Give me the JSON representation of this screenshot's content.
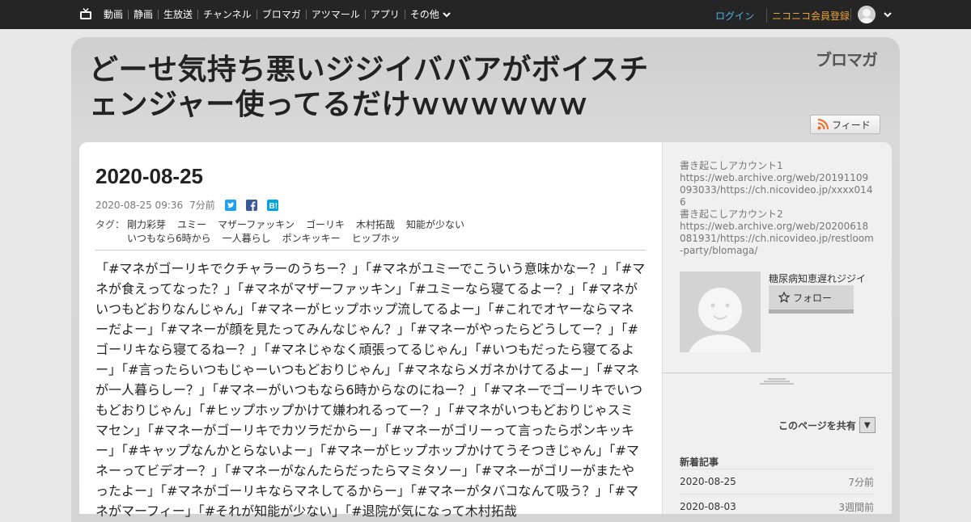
{
  "nav": {
    "items": [
      "動画",
      "静画",
      "生放送",
      "チャンネル",
      "ブロマガ",
      "アツマール",
      "アプリ"
    ],
    "more": "その他",
    "login": "ログイン",
    "register": "ニコニコ会員登録"
  },
  "header": {
    "blog_title": "どーせ気持ち悪いジジイババアがボイスチェンジャー使ってるだけｗｗｗｗｗｗ",
    "brand_logo": "ブロマガ",
    "feed_label": "フィード"
  },
  "article": {
    "date_title": "2020-08-25",
    "posted_at": "2020-08-25 09:36",
    "posted_ago": "7分前",
    "tags_label": "タグ：",
    "tags": [
      "剛力彩芽",
      "ユミー",
      "マザーファッキン",
      "ゴーリキ",
      "木村拓哉",
      "知能が少ない",
      "いつもなら6時から",
      "一人暮らし",
      "ポンキッキー",
      "ヒップホッ"
    ],
    "body": "「#マネがゴーリキでクチャラーのうちー？」「#マネがユミーでこういう意味かなー？」「#マネが食えってなった？」「#マネがマザーファッキン」「#ユミーなら寝てるよー？」「#マネがいつもどおりなんじゃん」「#マネーがヒップホップ流してるよー」「#これでオヤーならマネーだよー」「#マネーが顔を見たってみんなじゃん？」「#マネーがやったらどうしてー？」「#ゴーリキなら寝てるねー？」「#マネじゃなく頑張ってるじゃん」「#いつもだったら寝てるよー」「#言ったらいつもじゃーいつもどおりじゃん」「#マネならメガネかけてるよー」「#マネが一人暮らしー？」「#マネーがいつもなら6時からなのにねー？」「#マネーでゴーリキでいつもどおりじゃん」「#ヒップホップかけて嫌われるってー？」「#マネがいつもどおりじゃスミマセン」「#マネーがゴーリキでカツラだからー」「#マネーがゴリーって言ったらポンキッキー」「#キャップなんかとらないよー」「#マネーがヒップホップかけてうそつきじゃん」「#マネーってビデオー？」「#マネーがなんたらだったらマミタソー」「#マネーがゴリーがまたやったよー」「#マネがゴーリキならマネしてるからー」「#マネーがタバコなんて吸う？」「#マネがマーフィー」「#それが知能が少ない」「#退院が気になって木村拓哉"
  },
  "sidebar": {
    "profile_lines": [
      "書き起こしアカウント1",
      "https://web.archive.org/web/20191109093033/https://ch.nicovideo.jp/xxxx0146",
      "書き起こしアカウント2",
      "https://web.archive.org/web/20200618081931/https://ch.nicovideo.jp/restloom-party/blomaga/"
    ],
    "author_name": "糖尿病知恵遅れジジイ",
    "follow_label": "フォロー",
    "share_label": "このページを共有",
    "share_toggle": "▼",
    "recent_heading": "新着記事",
    "recent": [
      {
        "date": "2020-08-25",
        "ago": "7分前"
      },
      {
        "date": "2020-08-03",
        "ago": "3週間前"
      }
    ]
  },
  "colors": {
    "topbar": "#252525",
    "login": "#4fb2e6",
    "register": "#e8a23a",
    "twitter": "#1da1f2",
    "facebook": "#3b5998",
    "hatena": "#00a4de",
    "rss": "#f26522"
  }
}
